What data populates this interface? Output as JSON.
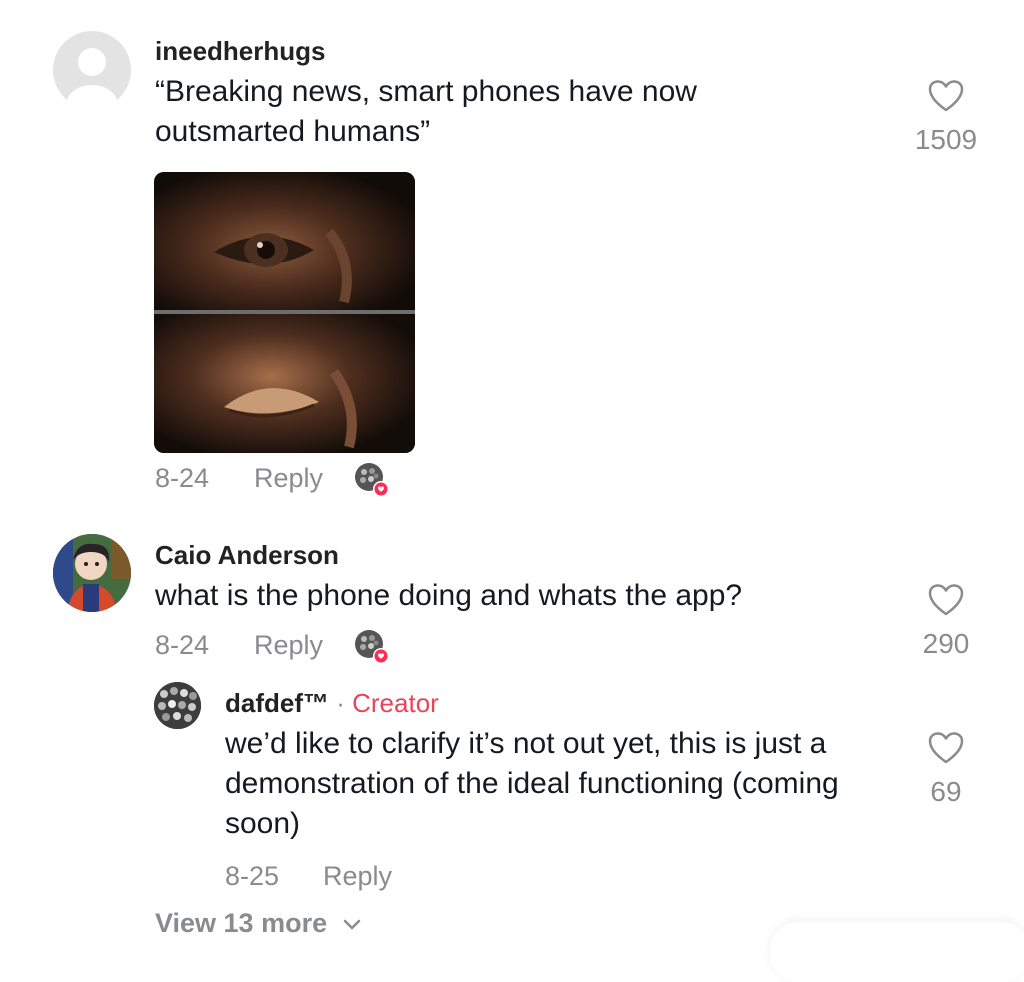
{
  "comments": [
    {
      "username": "ineedherhugs",
      "text": "“Breaking news, smart phones have now outsmarted humans”",
      "date": "8-24",
      "reply_label": "Reply",
      "likes": "1509",
      "avatar_icon": "default-user-icon"
    },
    {
      "username": "Caio Anderson",
      "text": "what is the phone doing and whats the app?",
      "date": "8-24",
      "reply_label": "Reply",
      "likes": "290",
      "avatar_icon": "profile-photo"
    }
  ],
  "reply": {
    "username": "dafdef™",
    "separator": " · ",
    "badge": "Creator",
    "text": "we’d like to clarify it’s not out yet, this is just a demonstration of the ideal functioning (coming soon)",
    "date": "8-25",
    "reply_label": "Reply",
    "likes": "69"
  },
  "view_more": {
    "label": "View 13 more"
  },
  "colors": {
    "creator": "#e8455b",
    "muted": "#8a8b91",
    "text": "#161823"
  }
}
